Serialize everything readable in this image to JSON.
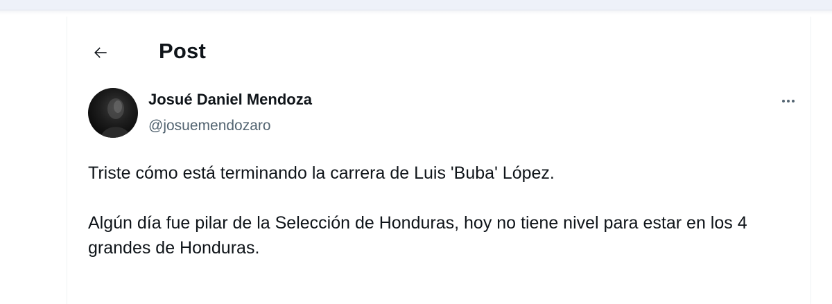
{
  "header": {
    "title": "Post",
    "back_icon": "arrow-left-icon"
  },
  "tweet": {
    "author": {
      "name": "Josué Daniel Mendoza",
      "handle": "@josuemendozaro",
      "avatar_icon": "avatar"
    },
    "more_icon": "ellipsis-icon",
    "paragraphs": [
      "Triste cómo está terminando la carrera de Luis 'Buba' López.",
      "Algún día fue pilar de la Selección de Honduras, hoy no tiene nivel para estar en los 4 grandes de Honduras."
    ]
  },
  "colors": {
    "text_primary": "#0f1419",
    "text_secondary": "#536471",
    "border": "#eff3f4",
    "top_strip": "#eef1f9"
  }
}
